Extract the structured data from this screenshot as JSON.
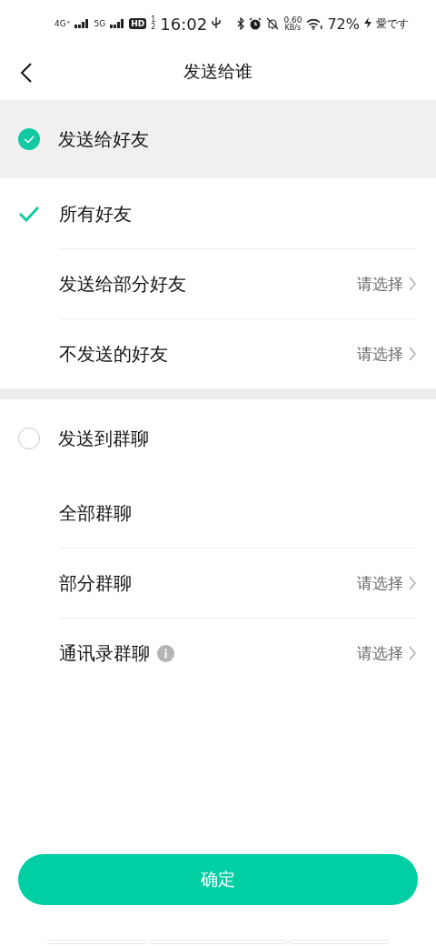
{
  "status_bar": {
    "sim1": "4G⁺",
    "sim2": "5G",
    "hd": "HD",
    "hd_sub": [
      "1",
      "2"
    ],
    "time": "16:02",
    "speed": "0.60",
    "speed_unit": "KB/s",
    "battery": "72%",
    "carrier": "愛です"
  },
  "header": {
    "title": "发送给谁"
  },
  "groups": [
    {
      "title": "发送给好友",
      "selected": true,
      "options": [
        {
          "label": "所有好友",
          "checked": true
        },
        {
          "label": "发送给部分好友",
          "checked": false,
          "action": "请选择"
        },
        {
          "label": "不发送的好友",
          "checked": false,
          "action": "请选择"
        }
      ]
    },
    {
      "title": "发送到群聊",
      "selected": false,
      "options": [
        {
          "label": "全部群聊",
          "checked": false
        },
        {
          "label": "部分群聊",
          "checked": false,
          "action": "请选择"
        },
        {
          "label": "通讯录群聊",
          "checked": false,
          "action": "请选择",
          "info": true
        }
      ]
    }
  ],
  "confirm_button": "确定"
}
